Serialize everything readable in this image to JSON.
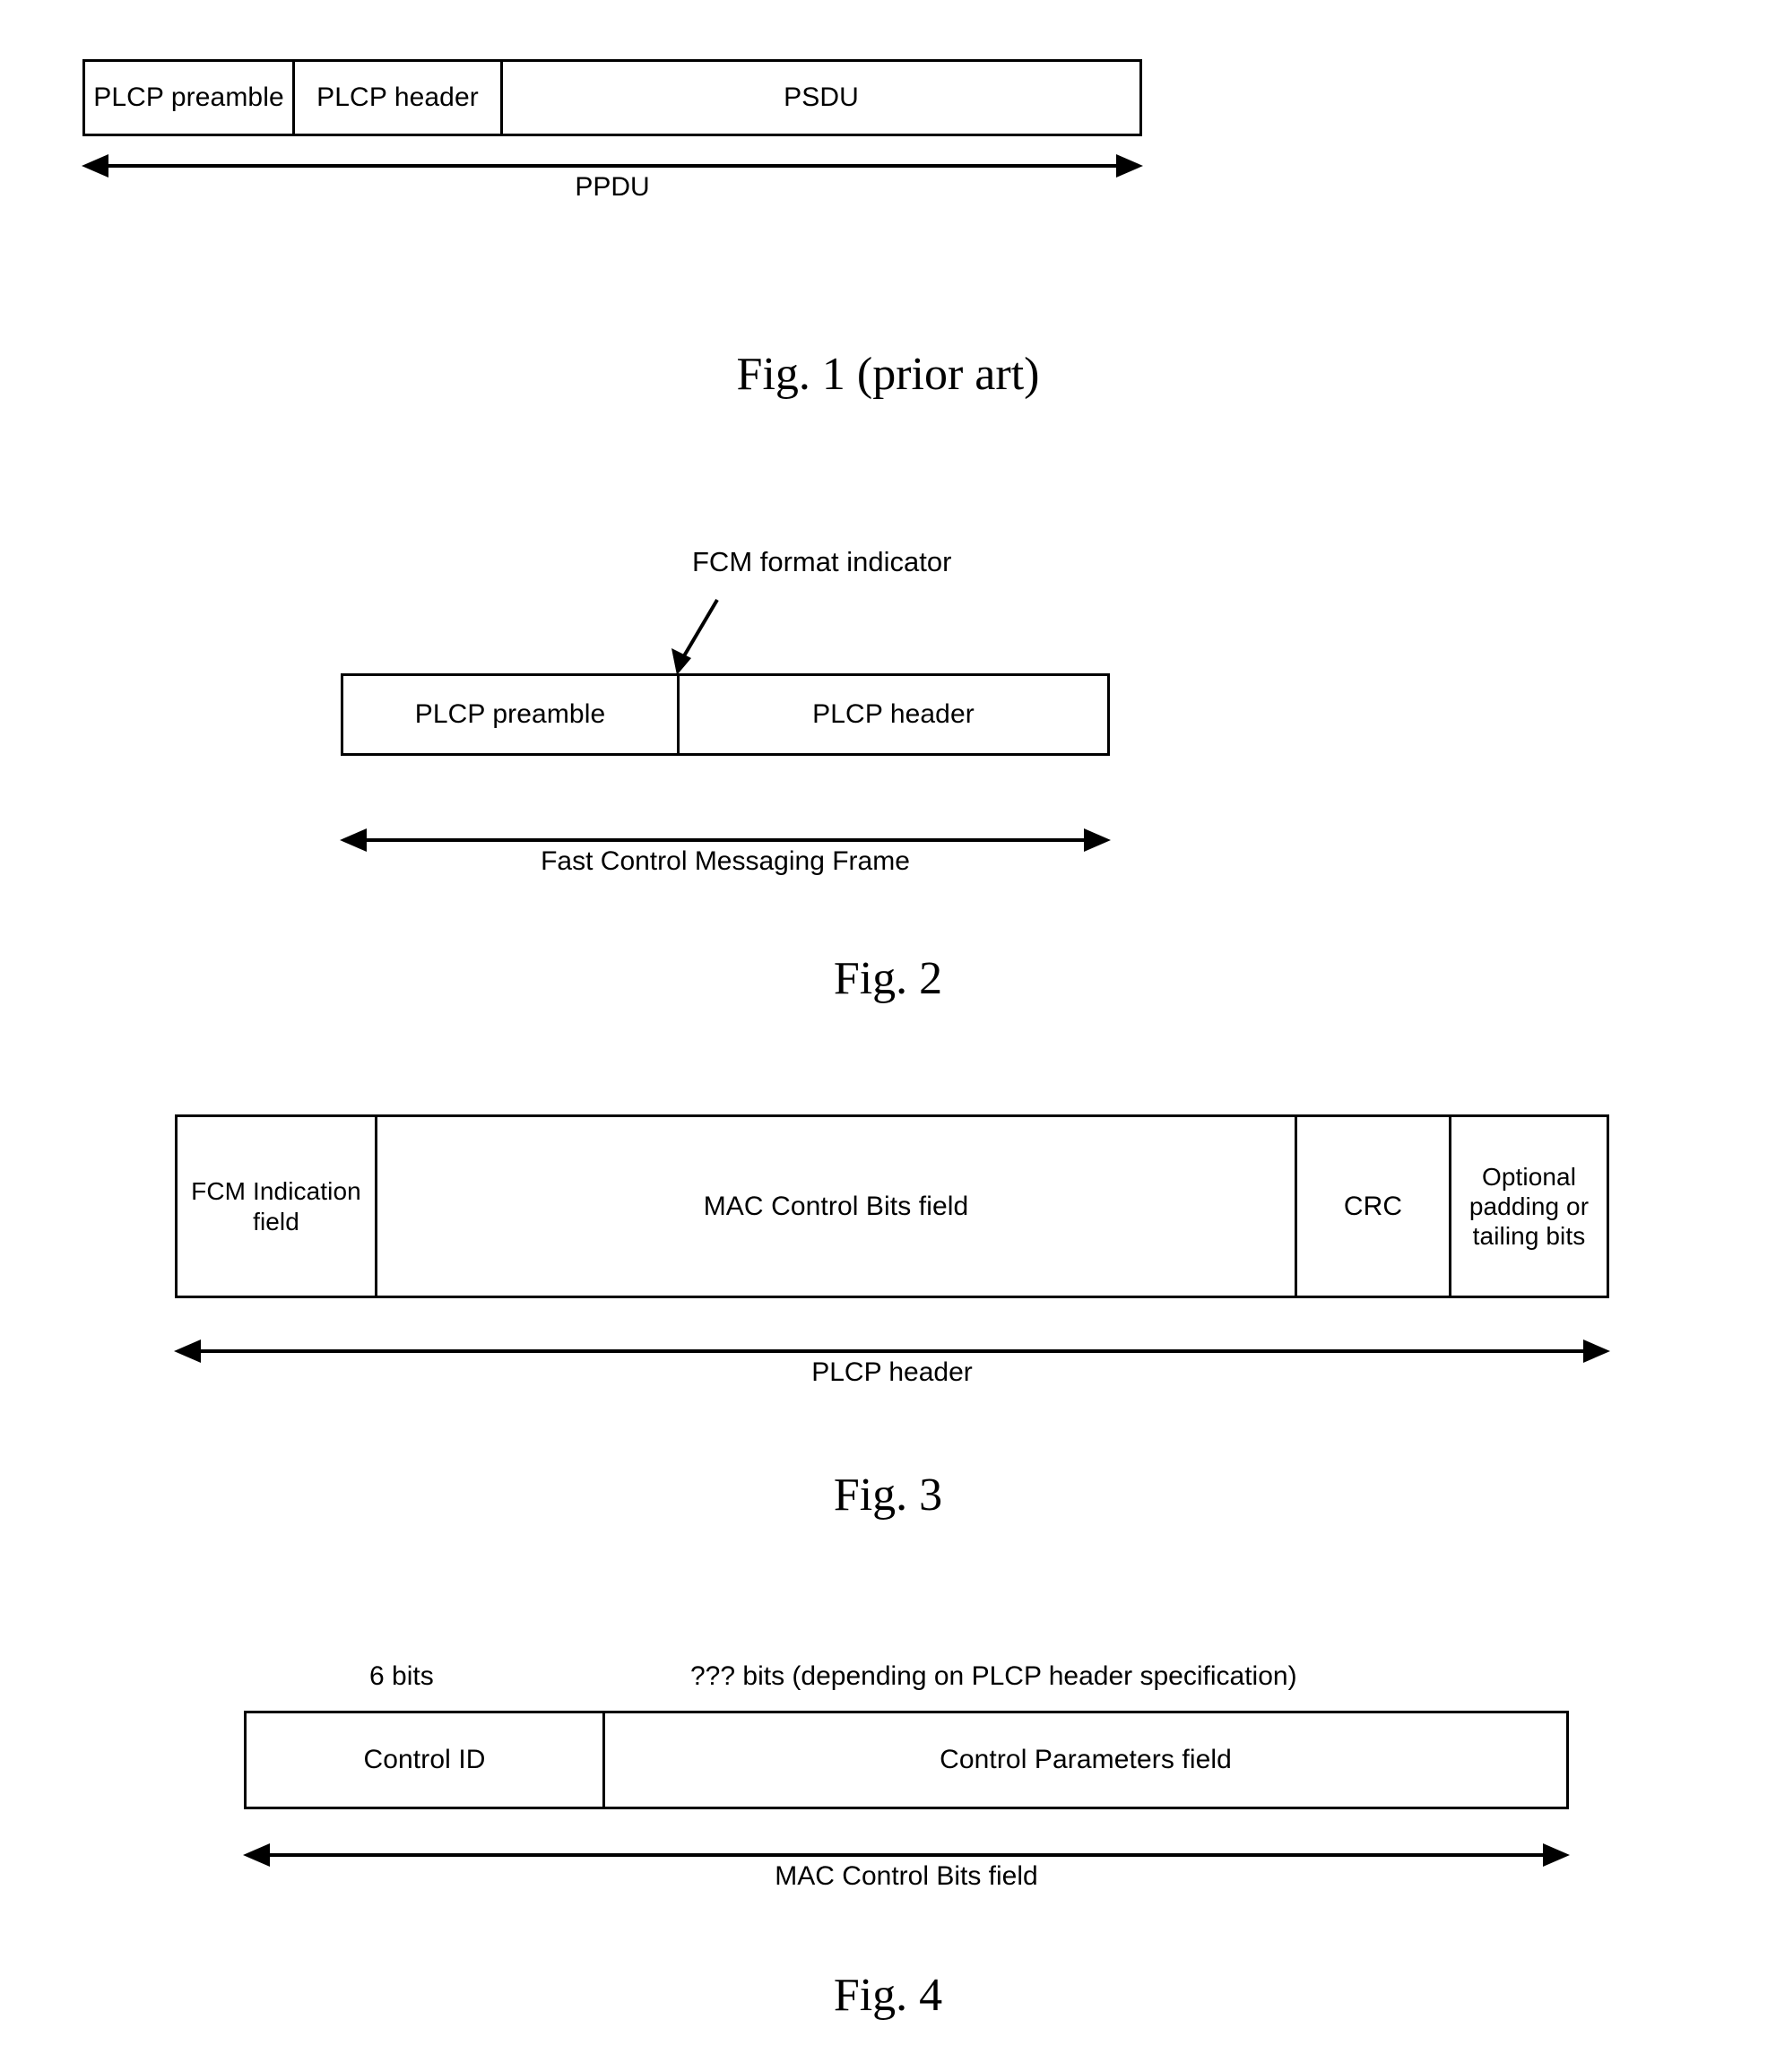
{
  "document": {
    "type": "patent-figure-sheet",
    "background_color": "#ffffff",
    "line_color": "#000000"
  },
  "figures": [
    {
      "id": "fig1",
      "caption": "Fig. 1 (prior art)",
      "boxes": [
        {
          "label": "PLCP preamble"
        },
        {
          "label": "PLCP header"
        },
        {
          "label": "PSDU"
        }
      ],
      "ruler_label": "PPDU"
    },
    {
      "id": "fig2",
      "caption": "Fig. 2",
      "annotation": "FCM format indicator",
      "boxes": [
        {
          "label": "PLCP preamble"
        },
        {
          "label": "PLCP header"
        }
      ],
      "ruler_label": "Fast Control Messaging Frame"
    },
    {
      "id": "fig3",
      "caption": "Fig. 3",
      "boxes": [
        {
          "label": "FCM Indication field"
        },
        {
          "label": "MAC Control Bits field"
        },
        {
          "label": "CRC"
        },
        {
          "label": "Optional padding or tailing bits"
        }
      ],
      "ruler_label": "PLCP header"
    },
    {
      "id": "fig4",
      "caption": "Fig. 4",
      "bit_labels": [
        {
          "text": "6 bits"
        },
        {
          "text": "??? bits (depending on PLCP header specification)"
        }
      ],
      "boxes": [
        {
          "label": "Control ID"
        },
        {
          "label": "Control Parameters field"
        }
      ],
      "ruler_label": "MAC Control Bits field"
    }
  ]
}
